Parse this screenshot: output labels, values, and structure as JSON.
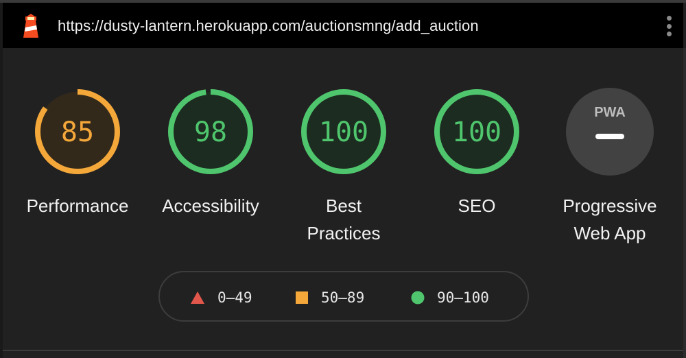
{
  "url_bar": {
    "url": "https://dusty-lantern.herokuapp.com/auctionsmng/add_auction"
  },
  "gauges": [
    {
      "id": "performance",
      "score": "85",
      "value": 85,
      "label": "Performance",
      "color": "#f4a83a"
    },
    {
      "id": "accessibility",
      "score": "98",
      "value": 98,
      "label": "Accessibility",
      "color": "#4fc66d"
    },
    {
      "id": "best-practices",
      "score": "100",
      "value": 100,
      "label_line1": "Best",
      "label_line2": "Practices",
      "color": "#4fc66d"
    },
    {
      "id": "seo",
      "score": "100",
      "value": 100,
      "label": "SEO",
      "color": "#4fc66d"
    },
    {
      "id": "pwa",
      "badge": "PWA",
      "label_line1": "Progressive",
      "label_line2": "Web App"
    }
  ],
  "legend": {
    "fail": {
      "range": "0–49",
      "color": "#e2574c",
      "icon": "triangle-icon"
    },
    "average": {
      "range": "50–89",
      "color": "#f4a83a",
      "icon": "square-icon"
    },
    "pass": {
      "range": "90–100",
      "color": "#4fc66d",
      "icon": "circle-icon"
    }
  }
}
